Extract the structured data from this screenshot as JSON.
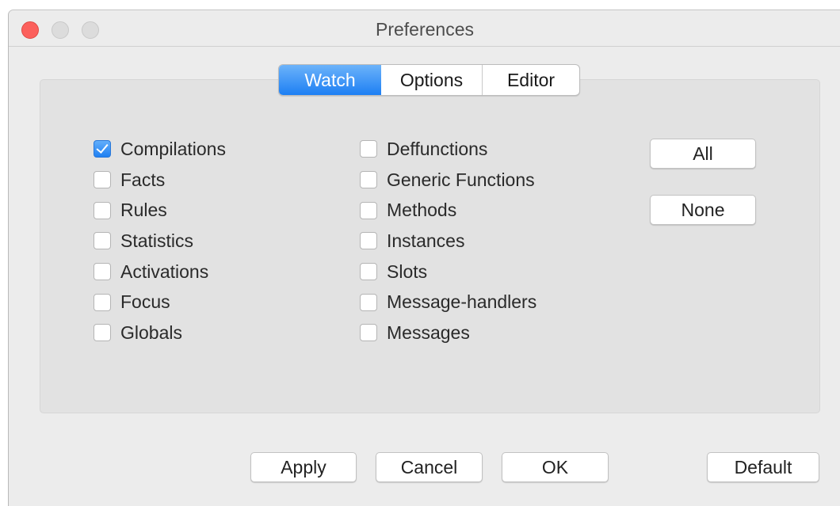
{
  "window": {
    "title": "Preferences"
  },
  "tabs": [
    {
      "label": "Watch",
      "active": true
    },
    {
      "label": "Options",
      "active": false
    },
    {
      "label": "Editor",
      "active": false
    }
  ],
  "watch_items_left": [
    {
      "label": "Compilations",
      "checked": true
    },
    {
      "label": "Facts",
      "checked": false
    },
    {
      "label": "Rules",
      "checked": false
    },
    {
      "label": "Statistics",
      "checked": false
    },
    {
      "label": "Activations",
      "checked": false
    },
    {
      "label": "Focus",
      "checked": false
    },
    {
      "label": "Globals",
      "checked": false
    }
  ],
  "watch_items_right": [
    {
      "label": "Deffunctions",
      "checked": false
    },
    {
      "label": "Generic Functions",
      "checked": false
    },
    {
      "label": "Methods",
      "checked": false
    },
    {
      "label": "Instances",
      "checked": false
    },
    {
      "label": "Slots",
      "checked": false
    },
    {
      "label": "Message-handlers",
      "checked": false
    },
    {
      "label": "Messages",
      "checked": false
    }
  ],
  "selection_buttons": {
    "all": "All",
    "none": "None"
  },
  "footer_buttons": {
    "apply": "Apply",
    "cancel": "Cancel",
    "ok": "OK",
    "default": "Default"
  },
  "colors": {
    "accent": "#1d7ff3",
    "close_button": "#fc605c",
    "window_bg": "#ececec"
  }
}
